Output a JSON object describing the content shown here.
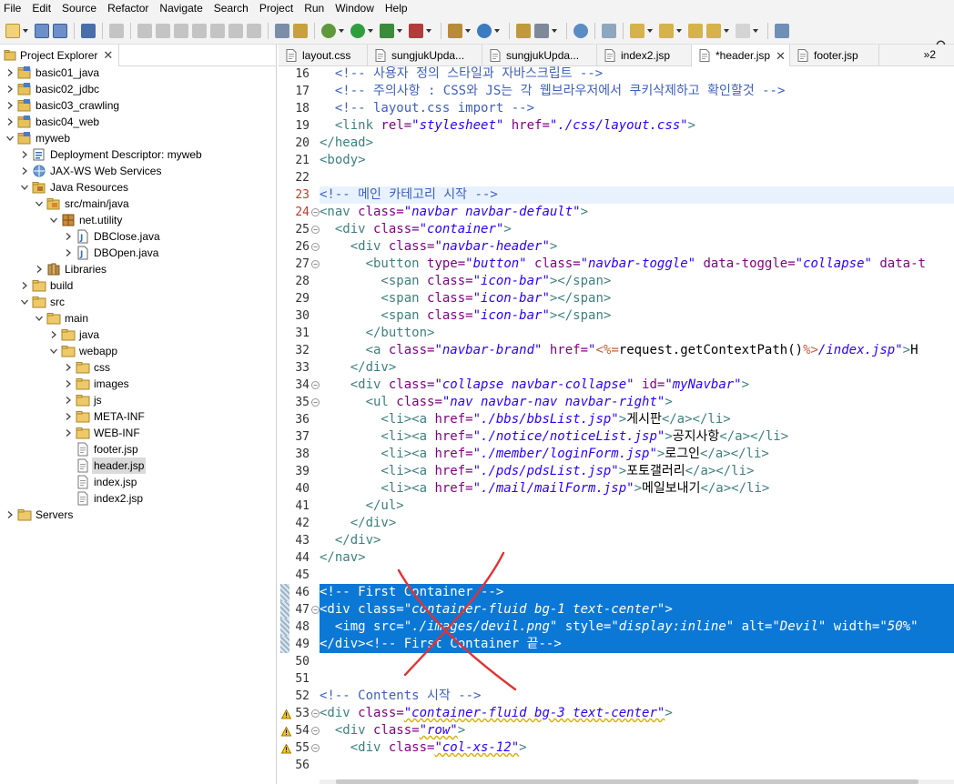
{
  "menu": [
    "File",
    "Edit",
    "Source",
    "Refactor",
    "Navigate",
    "Search",
    "Project",
    "Run",
    "Window",
    "Help"
  ],
  "explorer": {
    "tab_label": "Project Explorer",
    "tree": [
      {
        "label": "basic01_java",
        "level": 0,
        "icon": "project-icon",
        "expanded": false
      },
      {
        "label": "basic02_jdbc",
        "level": 0,
        "icon": "project-icon",
        "expanded": false
      },
      {
        "label": "basic03_crawling",
        "level": 0,
        "icon": "project-icon",
        "expanded": false
      },
      {
        "label": "basic04_web",
        "level": 0,
        "icon": "project-icon",
        "expanded": false
      },
      {
        "label": "myweb",
        "level": 0,
        "icon": "project-icon",
        "expanded": true
      },
      {
        "label": "Deployment Descriptor: myweb",
        "level": 1,
        "icon": "descriptor-icon",
        "expanded": false
      },
      {
        "label": "JAX-WS Web Services",
        "level": 1,
        "icon": "webservice-icon",
        "expanded": false
      },
      {
        "label": "Java Resources",
        "level": 1,
        "icon": "java-resources-icon",
        "expanded": true
      },
      {
        "label": "src/main/java",
        "level": 2,
        "icon": "source-folder-icon",
        "expanded": true
      },
      {
        "label": "net.utility",
        "level": 3,
        "icon": "package-icon",
        "expanded": true
      },
      {
        "label": "DBClose.java",
        "level": 4,
        "icon": "java-file-icon",
        "expanded": false
      },
      {
        "label": "DBOpen.java",
        "level": 4,
        "icon": "java-file-icon",
        "expanded": false
      },
      {
        "label": "Libraries",
        "level": 2,
        "icon": "library-icon",
        "expanded": false
      },
      {
        "label": "build",
        "level": 1,
        "icon": "folder-icon",
        "expanded": false
      },
      {
        "label": "src",
        "level": 1,
        "icon": "folder-icon",
        "expanded": true
      },
      {
        "label": "main",
        "level": 2,
        "icon": "folder-icon",
        "expanded": true
      },
      {
        "label": "java",
        "level": 3,
        "icon": "folder-icon",
        "expanded": false
      },
      {
        "label": "webapp",
        "level": 3,
        "icon": "folder-icon",
        "expanded": true
      },
      {
        "label": "css",
        "level": 4,
        "icon": "folder-icon",
        "expanded": false
      },
      {
        "label": "images",
        "level": 4,
        "icon": "folder-icon",
        "expanded": false
      },
      {
        "label": "js",
        "level": 4,
        "icon": "folder-icon",
        "expanded": false
      },
      {
        "label": "META-INF",
        "level": 4,
        "icon": "folder-icon",
        "expanded": false
      },
      {
        "label": "WEB-INF",
        "level": 4,
        "icon": "folder-icon",
        "expanded": false
      },
      {
        "label": "footer.jsp",
        "level": 4,
        "icon": "jsp-file-icon",
        "leaf": true
      },
      {
        "label": "header.jsp",
        "level": 4,
        "icon": "jsp-file-icon",
        "leaf": true,
        "selected": true
      },
      {
        "label": "index.jsp",
        "level": 4,
        "icon": "jsp-file-icon",
        "leaf": true
      },
      {
        "label": "index2.jsp",
        "level": 4,
        "icon": "jsp-file-icon",
        "leaf": true
      },
      {
        "label": "Servers",
        "level": 0,
        "icon": "servers-icon",
        "expanded": false
      }
    ]
  },
  "editor": {
    "tabs": [
      {
        "label": "layout.css",
        "active": false
      },
      {
        "label": "sungjukUpda...",
        "active": false
      },
      {
        "label": "sungjukUpda...",
        "active": false
      },
      {
        "label": "index2.jsp",
        "active": false
      },
      {
        "label": "*header.jsp",
        "active": true
      },
      {
        "label": "footer.jsp",
        "active": false
      }
    ],
    "overflow_label": "»2",
    "lines": [
      {
        "n": 16,
        "warn": false,
        "fold": false,
        "sel": false,
        "cur": false,
        "t": [
          [
            "com",
            "  <!-- 사용자 정의 스타일과 자바스크립트 -->"
          ]
        ]
      },
      {
        "n": 17,
        "t": [
          [
            "com",
            "  <!-- 주의사항 : CSS와 JS는 각 웹브라우저에서 쿠키삭제하고 확인할것 -->"
          ]
        ]
      },
      {
        "n": 18,
        "t": [
          [
            "com",
            "  <!-- layout.css import -->"
          ]
        ]
      },
      {
        "n": 19,
        "t": [
          [
            "tag",
            "  <link "
          ],
          [
            "attr",
            "rel="
          ],
          [
            "val",
            "\"stylesheet\""
          ],
          [
            "attr",
            " href="
          ],
          [
            "val",
            "\"./css/layout.css\""
          ],
          [
            "tag",
            ">"
          ]
        ]
      },
      {
        "n": 20,
        "t": [
          [
            "tag",
            "</head>"
          ]
        ]
      },
      {
        "n": 21,
        "t": [
          [
            "tag",
            "<body>"
          ]
        ]
      },
      {
        "n": 22,
        "t": [
          [
            "txt",
            ""
          ]
        ]
      },
      {
        "n": 23,
        "cur": true,
        "t": [
          [
            "com",
            "<!-- 메인 카테고리 시작 -->"
          ]
        ]
      },
      {
        "n": 24,
        "fold": true,
        "t": [
          [
            "tag",
            "<nav "
          ],
          [
            "attr",
            "class="
          ],
          [
            "val",
            "\"navbar navbar-default\""
          ],
          [
            "tag",
            ">"
          ]
        ]
      },
      {
        "n": 25,
        "fold": true,
        "t": [
          [
            "tag",
            "  <div "
          ],
          [
            "attr",
            "class="
          ],
          [
            "val",
            "\"container\""
          ],
          [
            "tag",
            ">"
          ]
        ]
      },
      {
        "n": 26,
        "fold": true,
        "t": [
          [
            "tag",
            "    <div "
          ],
          [
            "attr",
            "class="
          ],
          [
            "val",
            "\"navbar-header\""
          ],
          [
            "tag",
            ">"
          ]
        ]
      },
      {
        "n": 27,
        "fold": true,
        "t": [
          [
            "tag",
            "      <button "
          ],
          [
            "attr",
            "type="
          ],
          [
            "val",
            "\"button\""
          ],
          [
            "attr",
            " class="
          ],
          [
            "val",
            "\"navbar-toggle\""
          ],
          [
            "attr",
            " data-toggle="
          ],
          [
            "val",
            "\"collapse\""
          ],
          [
            "attr",
            " data-t"
          ]
        ]
      },
      {
        "n": 28,
        "t": [
          [
            "tag",
            "        <span "
          ],
          [
            "attr",
            "class="
          ],
          [
            "val",
            "\"icon-bar\""
          ],
          [
            "tag",
            "></span>"
          ]
        ]
      },
      {
        "n": 29,
        "t": [
          [
            "tag",
            "        <span "
          ],
          [
            "attr",
            "class="
          ],
          [
            "val",
            "\"icon-bar\""
          ],
          [
            "tag",
            "></span>"
          ]
        ]
      },
      {
        "n": 30,
        "t": [
          [
            "tag",
            "        <span "
          ],
          [
            "attr",
            "class="
          ],
          [
            "val",
            "\"icon-bar\""
          ],
          [
            "tag",
            "></span>"
          ]
        ]
      },
      {
        "n": 31,
        "t": [
          [
            "tag",
            "      </button>"
          ]
        ]
      },
      {
        "n": 32,
        "t": [
          [
            "tag",
            "      <a "
          ],
          [
            "attr",
            "class="
          ],
          [
            "val",
            "\"navbar-brand\""
          ],
          [
            "attr",
            " href="
          ],
          [
            "val",
            "\""
          ],
          [
            "jsp",
            "<%="
          ],
          [
            "txt",
            "request.getContextPath()"
          ],
          [
            "jsp",
            "%>"
          ],
          [
            "val",
            "/index.jsp\""
          ],
          [
            "tag",
            ">"
          ],
          [
            "txt",
            "H"
          ]
        ]
      },
      {
        "n": 33,
        "t": [
          [
            "tag",
            "    </div>"
          ]
        ]
      },
      {
        "n": 34,
        "fold": true,
        "t": [
          [
            "tag",
            "    <div "
          ],
          [
            "attr",
            "class="
          ],
          [
            "val",
            "\"collapse navbar-collapse\""
          ],
          [
            "attr",
            " id="
          ],
          [
            "val",
            "\"myNavbar\""
          ],
          [
            "tag",
            ">"
          ]
        ]
      },
      {
        "n": 35,
        "fold": true,
        "t": [
          [
            "tag",
            "      <ul "
          ],
          [
            "attr",
            "class="
          ],
          [
            "val",
            "\"nav navbar-nav navbar-right\""
          ],
          [
            "tag",
            ">"
          ]
        ]
      },
      {
        "n": 36,
        "t": [
          [
            "tag",
            "        <li><a "
          ],
          [
            "attr",
            "href="
          ],
          [
            "val",
            "\"./bbs/bbsList.jsp\""
          ],
          [
            "tag",
            ">"
          ],
          [
            "txt",
            "게시판"
          ],
          [
            "tag",
            "</a></li>"
          ]
        ]
      },
      {
        "n": 37,
        "t": [
          [
            "tag",
            "        <li><a "
          ],
          [
            "attr",
            "href="
          ],
          [
            "val",
            "\"./notice/noticeList.jsp\""
          ],
          [
            "tag",
            ">"
          ],
          [
            "txt",
            "공지사항"
          ],
          [
            "tag",
            "</a></li>"
          ]
        ]
      },
      {
        "n": 38,
        "t": [
          [
            "tag",
            "        <li><a "
          ],
          [
            "attr",
            "href="
          ],
          [
            "val",
            "\"./member/loginForm.jsp\""
          ],
          [
            "tag",
            ">"
          ],
          [
            "txt",
            "로그인"
          ],
          [
            "tag",
            "</a></li>"
          ]
        ]
      },
      {
        "n": 39,
        "t": [
          [
            "tag",
            "        <li><a "
          ],
          [
            "attr",
            "href="
          ],
          [
            "val",
            "\"./pds/pdsList.jsp\""
          ],
          [
            "tag",
            ">"
          ],
          [
            "txt",
            "포토갤러리"
          ],
          [
            "tag",
            "</a></li>"
          ]
        ]
      },
      {
        "n": 40,
        "t": [
          [
            "tag",
            "        <li><a "
          ],
          [
            "attr",
            "href="
          ],
          [
            "val",
            "\"./mail/mailForm.jsp\""
          ],
          [
            "tag",
            ">"
          ],
          [
            "txt",
            "메일보내기"
          ],
          [
            "tag",
            "</a></li>"
          ]
        ]
      },
      {
        "n": 41,
        "t": [
          [
            "tag",
            "      </ul>"
          ]
        ]
      },
      {
        "n": 42,
        "t": [
          [
            "tag",
            "    </div>"
          ]
        ]
      },
      {
        "n": 43,
        "t": [
          [
            "tag",
            "  </div>"
          ]
        ]
      },
      {
        "n": 44,
        "t": [
          [
            "tag",
            "</nav>"
          ]
        ]
      },
      {
        "n": 45,
        "t": [
          [
            "txt",
            ""
          ]
        ]
      },
      {
        "n": 46,
        "sel": true,
        "t": [
          [
            "com",
            "<!-- First Container -->"
          ]
        ]
      },
      {
        "n": 47,
        "sel": true,
        "fold": true,
        "t": [
          [
            "tag",
            "<div "
          ],
          [
            "attr",
            "class="
          ],
          [
            "val",
            "\"container-fluid bg-1 text-center\""
          ],
          [
            "tag",
            ">"
          ]
        ]
      },
      {
        "n": 48,
        "sel": true,
        "t": [
          [
            "tag",
            "  <img "
          ],
          [
            "attr",
            "src="
          ],
          [
            "val",
            "\"./images/devil.png\""
          ],
          [
            "attr",
            " style="
          ],
          [
            "val",
            "\"display:inline\""
          ],
          [
            "attr",
            " alt="
          ],
          [
            "val",
            "\"Devil\""
          ],
          [
            "attr",
            " width="
          ],
          [
            "val",
            "\"50%\""
          ]
        ]
      },
      {
        "n": 49,
        "sel": true,
        "t": [
          [
            "tag",
            "</div>"
          ],
          [
            "com",
            "<!-- First Container 끝-->"
          ]
        ]
      },
      {
        "n": 50,
        "t": [
          [
            "txt",
            ""
          ]
        ]
      },
      {
        "n": 51,
        "t": [
          [
            "txt",
            ""
          ]
        ]
      },
      {
        "n": 52,
        "t": [
          [
            "com",
            "<!-- Contents 시작 -->"
          ]
        ]
      },
      {
        "n": 53,
        "warn": true,
        "fold": true,
        "t": [
          [
            "tag",
            "<div "
          ],
          [
            "attr",
            "class="
          ],
          [
            "val",
            "\"container-fluid bg-3 text-center\""
          ],
          [
            "tag",
            ">"
          ]
        ]
      },
      {
        "n": 54,
        "warn": true,
        "fold": true,
        "t": [
          [
            "tag",
            "  <div "
          ],
          [
            "attr",
            "class="
          ],
          [
            "val",
            "\"row\""
          ],
          [
            "tag",
            ">"
          ]
        ]
      },
      {
        "n": 55,
        "warn": true,
        "fold": true,
        "t": [
          [
            "tag",
            "    <div "
          ],
          [
            "attr",
            "class="
          ],
          [
            "val",
            "\"col-xs-12\""
          ],
          [
            "tag",
            ">"
          ]
        ]
      },
      {
        "n": 56,
        "t": [
          [
            "txt",
            ""
          ]
        ]
      }
    ]
  }
}
